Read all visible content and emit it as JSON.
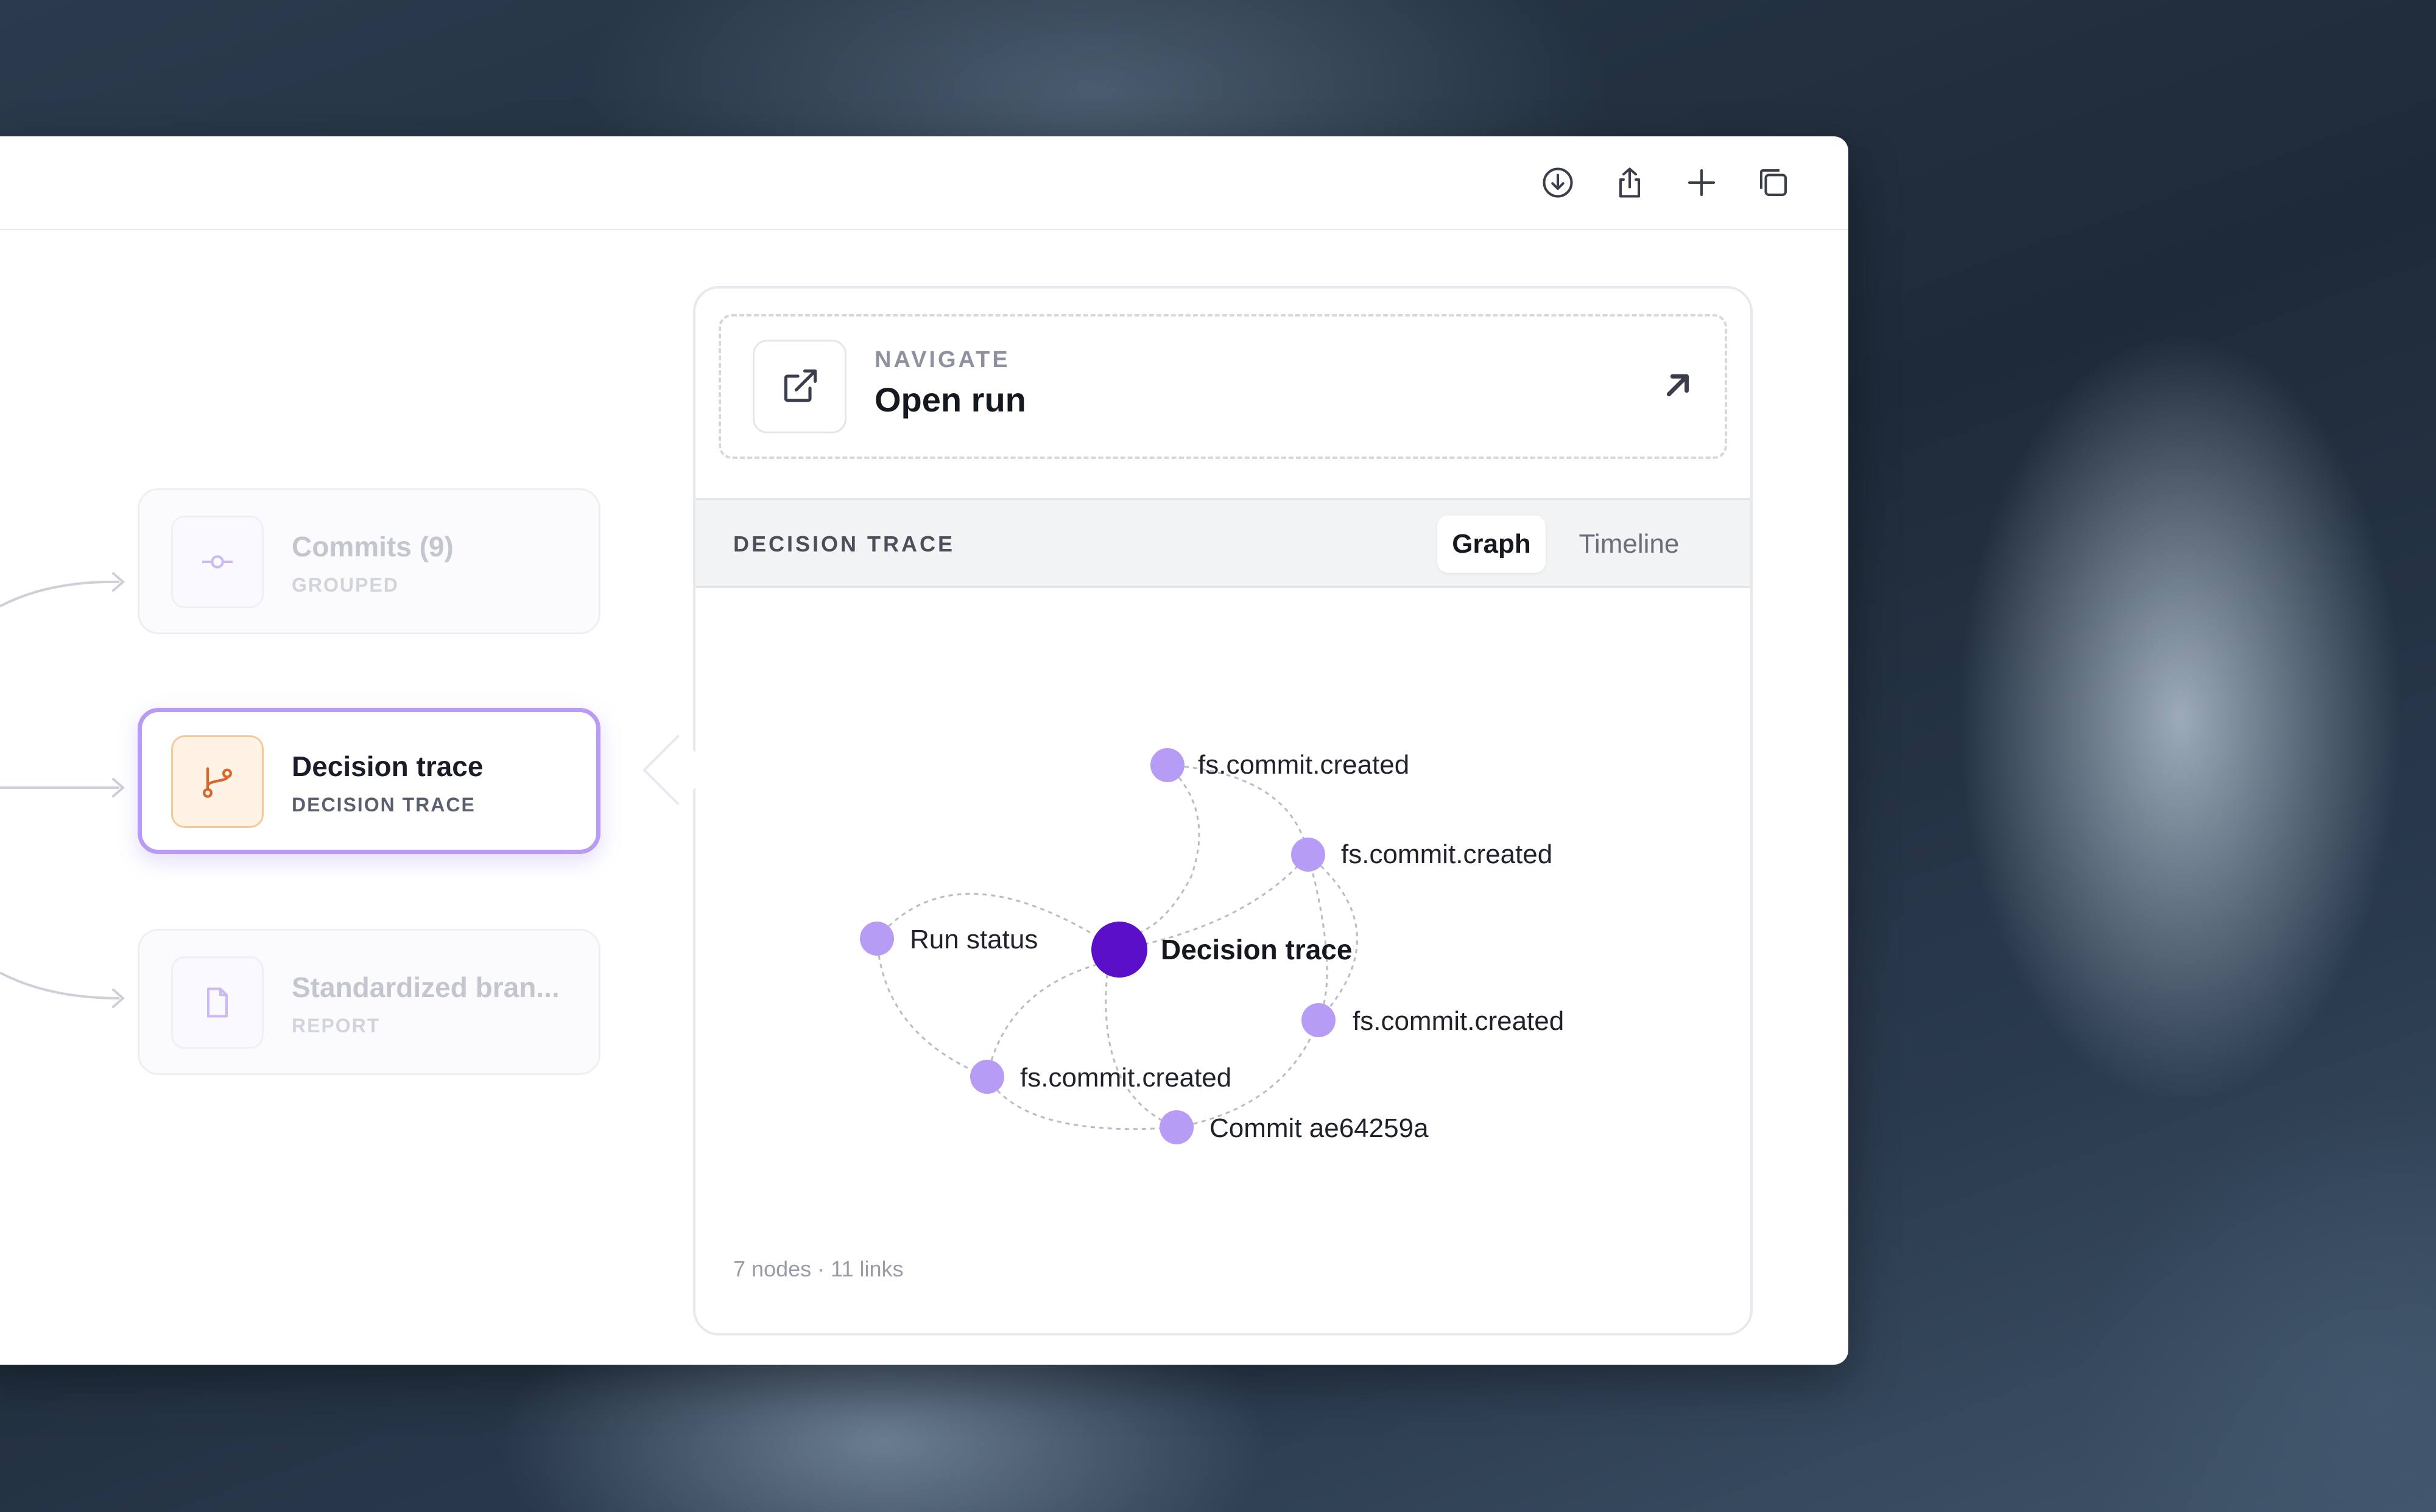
{
  "toolbar": {
    "download_icon": "download-icon",
    "share_icon": "share-icon",
    "new_tab_icon": "plus-icon",
    "tabs_overview_icon": "tabs-icon"
  },
  "pipeline": {
    "nodes": [
      {
        "title": "Commits (9)",
        "subtitle": "GROUPED",
        "icon": "commit-icon",
        "state": "dimmed"
      },
      {
        "title": "Decision trace",
        "subtitle": "DECISION TRACE",
        "icon": "branch-icon",
        "state": "selected"
      },
      {
        "title": "Standardized bran...",
        "subtitle": "REPORT",
        "icon": "document-icon",
        "state": "dimmed"
      }
    ]
  },
  "inspector": {
    "navigate": {
      "kicker": "NAVIGATE",
      "title": "Open run",
      "icon": "external-link-icon",
      "action_icon": "arrow-up-right-icon"
    },
    "trace": {
      "label": "DECISION TRACE",
      "tabs": [
        {
          "label": "Graph",
          "active": true
        },
        {
          "label": "Timeline",
          "active": false
        }
      ],
      "graph": {
        "nodes": [
          {
            "label": "Decision trace",
            "kind": "root"
          },
          {
            "label": "fs.commit.created",
            "kind": "event"
          },
          {
            "label": "fs.commit.created",
            "kind": "event"
          },
          {
            "label": "Run status",
            "kind": "event"
          },
          {
            "label": "fs.commit.created",
            "kind": "event"
          },
          {
            "label": "fs.commit.created",
            "kind": "event"
          },
          {
            "label": "Commit ae64259a",
            "kind": "event"
          }
        ]
      },
      "stats": "7 nodes · 11 links"
    }
  },
  "colors": {
    "accent": "#b79bf5",
    "node_root": "#5b0fc8",
    "node_event": "#b79cf6",
    "icon_orange": "#d9662a"
  }
}
